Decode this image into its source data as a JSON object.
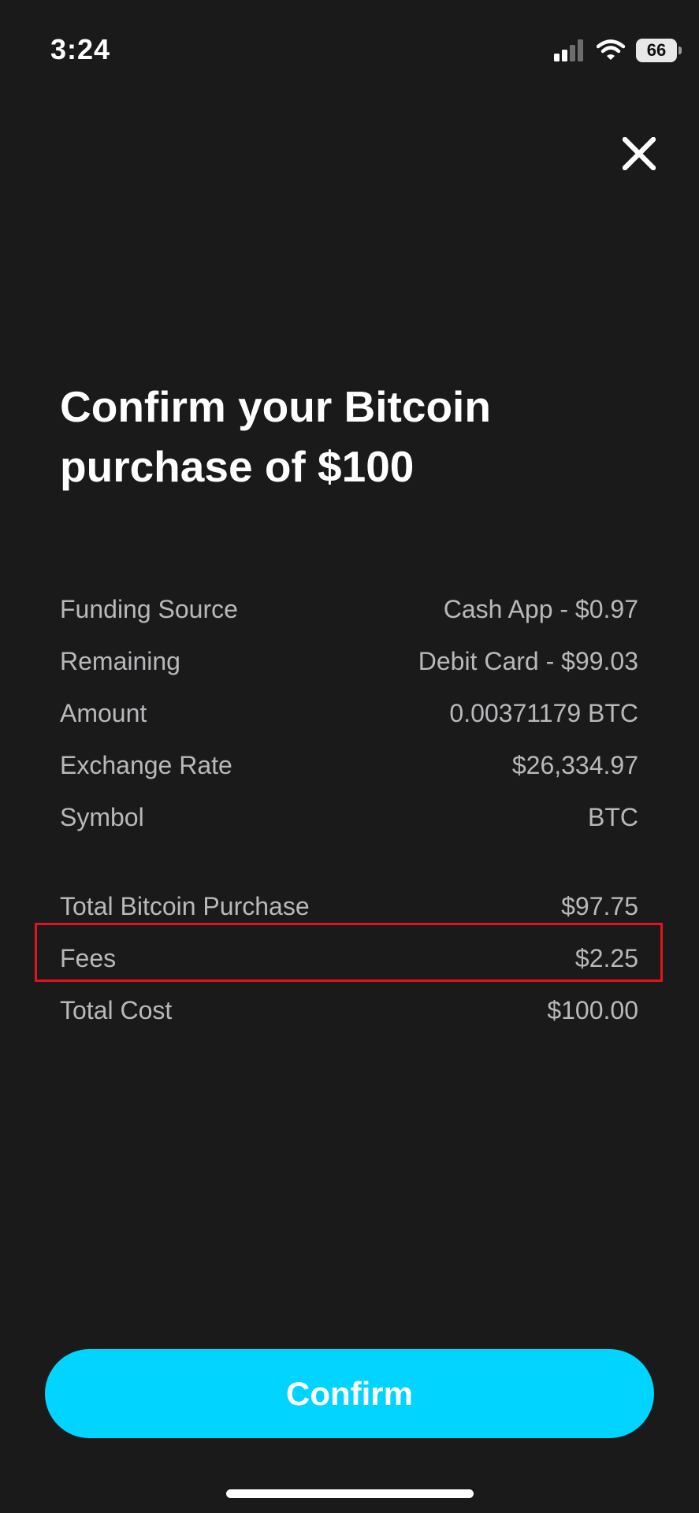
{
  "status_bar": {
    "time": "3:24",
    "battery": "66",
    "icons": [
      "cellular-signal-icon",
      "wifi-icon",
      "battery-icon"
    ]
  },
  "header": {
    "close_icon": "close-icon"
  },
  "title": "Confirm your Bitcoin purchase of $100",
  "details": [
    {
      "label": "Funding Source",
      "value": "Cash App - $0.97"
    },
    {
      "label": "Remaining",
      "value": "Debit Card - $99.03"
    },
    {
      "label": "Amount",
      "value": "0.00371179 BTC"
    },
    {
      "label": "Exchange Rate",
      "value": "$26,334.97"
    },
    {
      "label": "Symbol",
      "value": "BTC"
    }
  ],
  "totals": [
    {
      "label": "Total Bitcoin Purchase",
      "value": "$97.75"
    },
    {
      "label": "Fees",
      "value": "$2.25"
    },
    {
      "label": "Total Cost",
      "value": "$100.00"
    }
  ],
  "confirm_label": "Confirm",
  "colors": {
    "background": "#1a1a1b",
    "accent": "#00d4ff",
    "highlight": "#e0141c",
    "text_secondary": "#b9b9bc"
  }
}
